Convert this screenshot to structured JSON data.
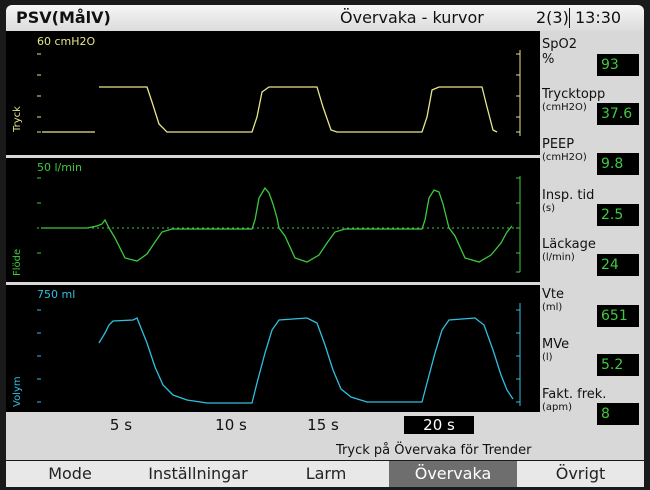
{
  "header": {
    "mode": "PSV(MålV)",
    "title": "Övervaka - kurvor",
    "page": "2(3)",
    "time": "13:30"
  },
  "panels": {
    "pressure": {
      "axis_label": "Tryck",
      "scale": "60 cmH2O",
      "color": "#e6e68a"
    },
    "flow": {
      "axis_label": "Flöde",
      "scale": "50 l/min",
      "color": "#3ec93e"
    },
    "volume": {
      "axis_label": "Volym",
      "scale": "750 ml",
      "color": "#2fc0e0"
    }
  },
  "time_axis": {
    "ticks": [
      "5 s",
      "10 s",
      "15 s",
      "20 s"
    ],
    "current": "20 s"
  },
  "params": [
    {
      "name": "SpO2",
      "unit": "%",
      "value": "93"
    },
    {
      "name": "Trycktopp",
      "unit": "(cmH2O)",
      "value": "37.6"
    },
    {
      "name": "PEEP",
      "unit": "(cmH2O)",
      "value": "9.8"
    },
    {
      "name": "Insp. tid",
      "unit": "(s)",
      "value": "2.5"
    },
    {
      "name": "Läckage",
      "unit": "(l/min)",
      "value": "24"
    },
    {
      "name": "Vte",
      "unit": "(ml)",
      "value": "651"
    },
    {
      "name": "MVe",
      "unit": "(l)",
      "value": "5.2"
    },
    {
      "name": "Fakt. frek.",
      "unit": "(apm)",
      "value": "8"
    }
  ],
  "hint": "Tryck på Övervaka för Trender",
  "menu": [
    {
      "label": "Mode",
      "active": false
    },
    {
      "label": "Inställningar",
      "active": false
    },
    {
      "label": "Larm",
      "active": false
    },
    {
      "label": "Övervaka",
      "active": true
    },
    {
      "label": "Övrigt",
      "active": false
    }
  ]
}
